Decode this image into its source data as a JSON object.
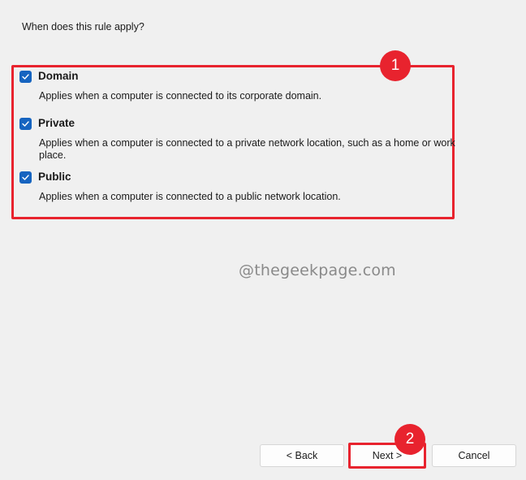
{
  "question": "When does this rule apply?",
  "options": [
    {
      "title": "Domain",
      "description": "Applies when a computer is connected to its corporate domain.",
      "checked": true
    },
    {
      "title": "Private",
      "description": "Applies when a computer is connected to a private network location, such as a home or work place.",
      "checked": true
    },
    {
      "title": "Public",
      "description": "Applies when a computer is connected to a public network location.",
      "checked": true
    }
  ],
  "badges": {
    "first": "1",
    "second": "2"
  },
  "watermark": "@thegeekpage.com",
  "buttons": {
    "back": "< Back",
    "next": "Next >",
    "cancel": "Cancel"
  },
  "colors": {
    "accent": "#1664c0",
    "highlight": "#e8232e",
    "background": "#f0f0f0"
  }
}
